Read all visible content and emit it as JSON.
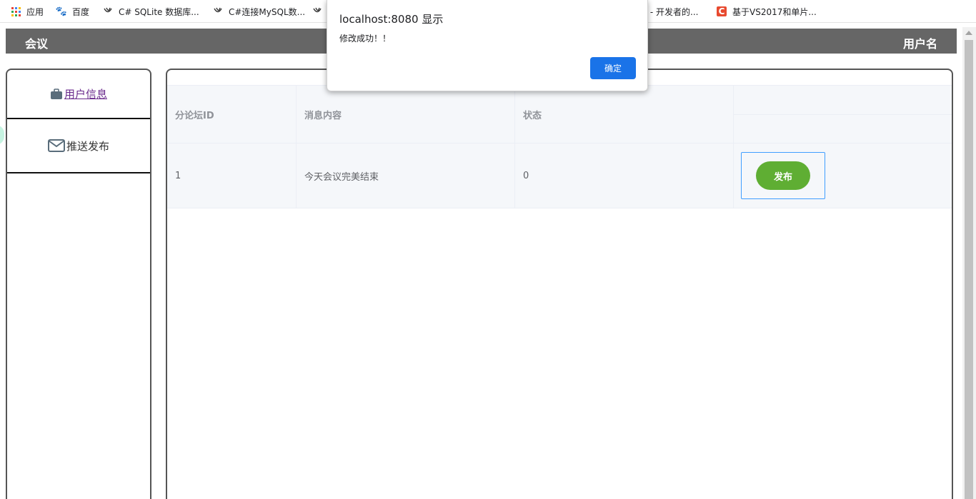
{
  "bookmarks": [
    {
      "label": "应用",
      "icon": "apps-grid-icon"
    },
    {
      "label": "百度",
      "icon": "baidu-icon"
    },
    {
      "label": "C# SQLite 数据库...",
      "icon": "swirl-icon"
    },
    {
      "label": "C#连接MySQL数...",
      "icon": "swirl-icon"
    },
    {
      "label": "",
      "icon": "swirl-icon"
    },
    {
      "label": "| - 开发者的...",
      "icon": ""
    },
    {
      "label": "基于VS2017和单片...",
      "icon": "csdn-icon"
    }
  ],
  "header": {
    "brand": "会议",
    "user": "用户名"
  },
  "sidebar": {
    "items": [
      {
        "label": "用户信息",
        "icon": "briefcase-icon"
      },
      {
        "label": "推送发布",
        "icon": "envelope-icon"
      }
    ]
  },
  "table": {
    "headers": [
      "分论坛ID",
      "消息内容",
      "状态"
    ],
    "rows": [
      {
        "id": "1",
        "content": "今天会议完美结束",
        "status": "0",
        "action": "发布"
      }
    ]
  },
  "dialog": {
    "title": "localhost:8080 显示",
    "message": "修改成功！！",
    "ok": "确定"
  },
  "colors": {
    "header_bg": "#666666",
    "publish_button": "#5fae33",
    "dialog_ok": "#1a73e8",
    "active_link": "#6a2a8c"
  }
}
